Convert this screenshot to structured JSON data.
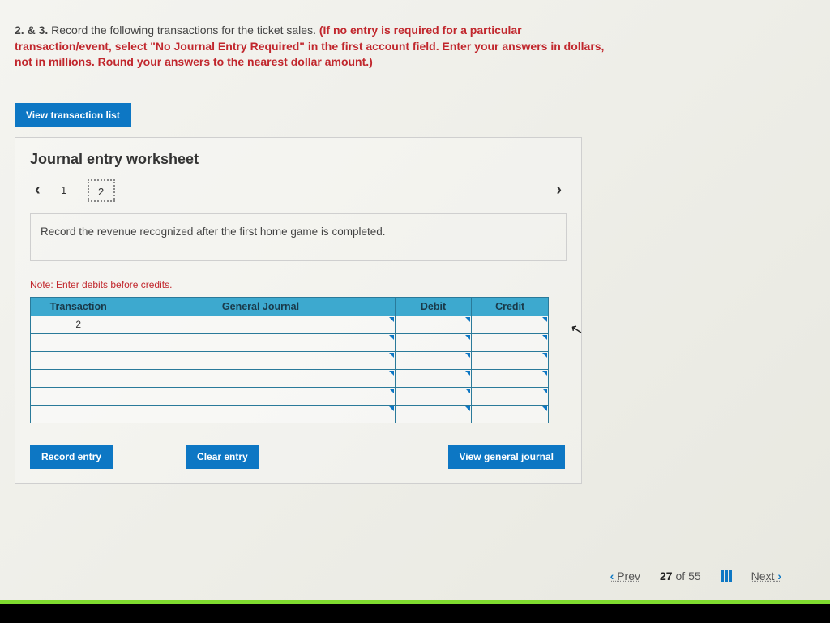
{
  "instructions": {
    "q_prefix": "2. & 3.",
    "normal": " Record the following transactions for the ticket sales. ",
    "red": "(If no entry is required for a particular transaction/event, select \"No Journal Entry Required\" in the first account field. Enter your answers in dollars, not in millions. Round your answers to the nearest dollar amount.)"
  },
  "buttons": {
    "view_tx": "View transaction list",
    "record": "Record entry",
    "clear": "Clear entry",
    "view_gj": "View general journal"
  },
  "worksheet": {
    "title": "Journal entry worksheet",
    "pages": [
      "1",
      "2"
    ],
    "active_page_index": 1,
    "prompt": "Record the revenue recognized after the first home game is completed.",
    "note": "Note: Enter debits before credits.",
    "headers": {
      "transaction": "Transaction",
      "general_journal": "General Journal",
      "debit": "Debit",
      "credit": "Credit"
    },
    "first_tx": "2"
  },
  "footer": {
    "prev": "Prev",
    "next": "Next",
    "current": "27",
    "of": "of",
    "total": "55"
  }
}
